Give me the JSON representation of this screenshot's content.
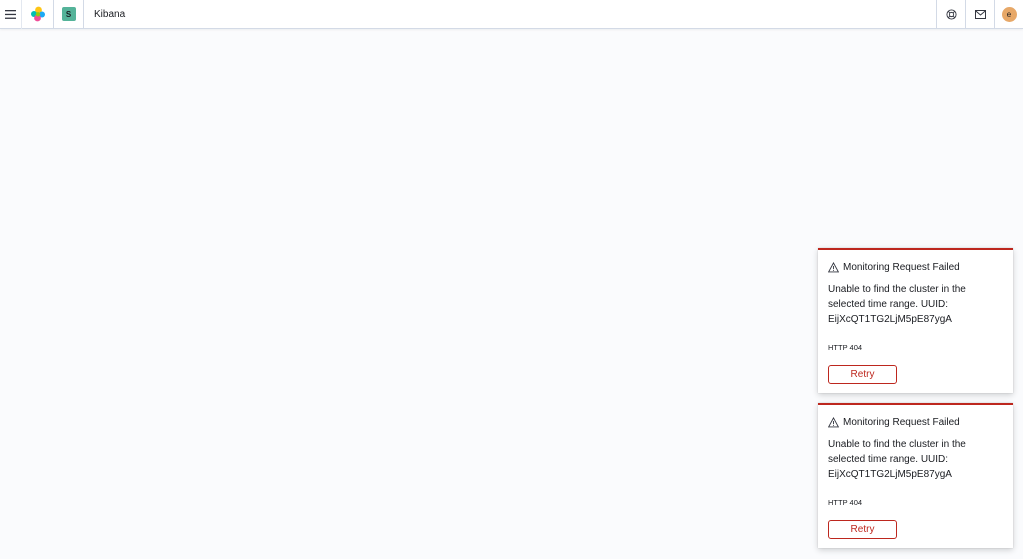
{
  "header": {
    "space_initial": "S",
    "app_title": "Kibana",
    "user_initial": "e"
  },
  "toasts": [
    {
      "title": "Monitoring Request Failed",
      "message": "Unable to find the cluster in the selected time range. UUID: EijXcQT1TG2LjM5pE87ygA",
      "code": "HTTP 404",
      "retry_label": "Retry"
    },
    {
      "title": "Monitoring Request Failed",
      "message": "Unable to find the cluster in the selected time range. UUID: EijXcQT1TG2LjM5pE87ygA",
      "code": "HTTP 404",
      "retry_label": "Retry"
    }
  ],
  "colors": {
    "danger": "#bd271e",
    "space_avatar": "#54b399",
    "user_avatar": "#e7a868"
  }
}
